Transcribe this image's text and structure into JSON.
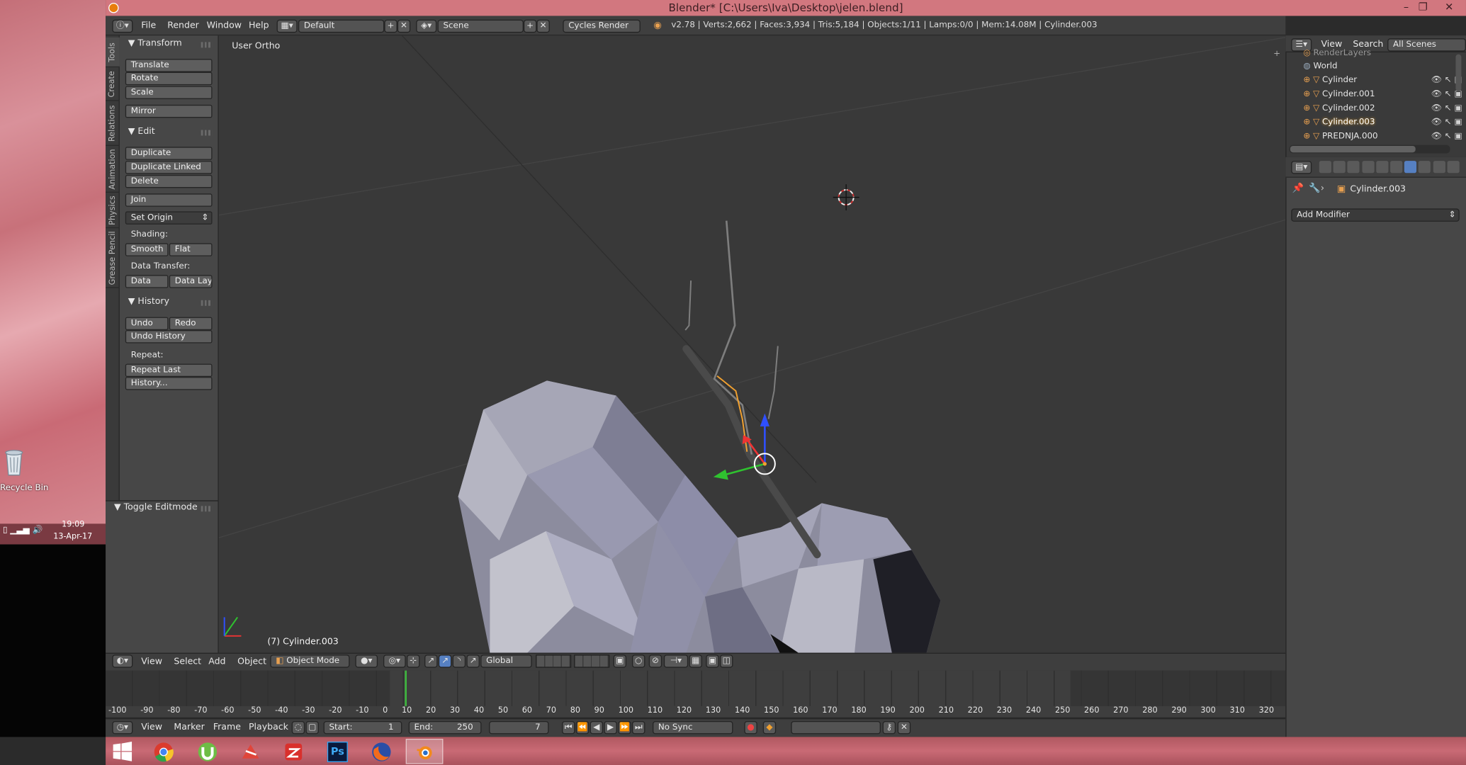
{
  "window": {
    "title": "Blender* [C:\\Users\\Iva\\Desktop\\jelen.blend]",
    "controls": [
      "–",
      "❐",
      "✕"
    ]
  },
  "menubar": {
    "menus": [
      "File",
      "Render",
      "Window",
      "Help"
    ],
    "screen_layout": "Default",
    "scene": "Scene",
    "render_engine": "Cycles Render",
    "stats": "v2.78 | Verts:2,662 | Faces:3,934 | Tris:5,184 | Objects:1/11 | Lamps:0/0 | Mem:14.08M | Cylinder.003"
  },
  "left_tabs": [
    "Tools",
    "Create",
    "Relations",
    "Animation",
    "Physics",
    "Grease Pencil"
  ],
  "toolshelf": {
    "transform": {
      "title": "Transform",
      "buttons": [
        "Translate",
        "Rotate",
        "Scale",
        "Mirror"
      ]
    },
    "edit": {
      "title": "Edit",
      "buttons": [
        "Duplicate",
        "Duplicate Linked",
        "Delete",
        "Join"
      ],
      "set_origin": "Set Origin",
      "shading_label": "Shading:",
      "shading_buttons": [
        "Smooth",
        "Flat"
      ],
      "data_transfer_label": "Data Transfer:",
      "data_transfer_buttons": [
        "Data",
        "Data Layo"
      ]
    },
    "history": {
      "title": "History",
      "undo": "Undo",
      "redo": "Redo",
      "undo_history": "Undo History",
      "repeat_label": "Repeat:",
      "repeat_last": "Repeat Last",
      "history": "History..."
    },
    "operator_panel": {
      "title": "Toggle Editmode"
    }
  },
  "viewport": {
    "view_label": "User Ortho",
    "object_label": "(7) Cylinder.003"
  },
  "viewport_header": {
    "menus": [
      "View",
      "Select",
      "Add",
      "Object"
    ],
    "mode": "Object Mode",
    "orientation": "Global"
  },
  "timeline": {
    "ticks": [
      "-100",
      "-90",
      "-80",
      "-70",
      "-60",
      "-50",
      "-40",
      "-30",
      "-20",
      "-10",
      "0",
      "10",
      "20",
      "30",
      "40",
      "50",
      "60",
      "70",
      "80",
      "90",
      "100",
      "110",
      "120",
      "130",
      "140",
      "150",
      "160",
      "170",
      "180",
      "190",
      "200",
      "210",
      "220",
      "230",
      "240",
      "250",
      "260",
      "270",
      "280",
      "290",
      "300",
      "310",
      "320"
    ],
    "current_frame_value": 7,
    "menus": [
      "View",
      "Marker",
      "Frame",
      "Playback"
    ],
    "start_label": "Start:",
    "start": "1",
    "end_label": "End:",
    "end": "250",
    "frame": "7",
    "sync": "No Sync"
  },
  "outliner": {
    "menus": [
      "View",
      "Search"
    ],
    "filter": "All Scenes",
    "items": [
      {
        "name": "RenderLayers"
      },
      {
        "name": "World"
      },
      {
        "name": "Cylinder"
      },
      {
        "name": "Cylinder.001"
      },
      {
        "name": "Cylinder.002"
      },
      {
        "name": "Cylinder.003",
        "selected": true
      },
      {
        "name": "PREDNJA.000"
      }
    ]
  },
  "properties": {
    "object_name": "Cylinder.003",
    "add_modifier": "Add Modifier"
  },
  "desktop": {
    "recycle_bin": "Recycle Bin",
    "time": "19:09",
    "date": "13-Apr-17"
  },
  "taskbar": {
    "apps": [
      "windows-start-icon",
      "chrome-icon",
      "utorrent-icon",
      "filezilla-icon",
      "wps-icon",
      "photoshop-icon",
      "firefox-icon",
      "blender-icon"
    ],
    "photoshop_label": "Ps"
  },
  "colors": {
    "title_bar": "#d2777f",
    "selection_orange": "#f0a030",
    "timeline_cursor": "#3fb83f",
    "outliner_highlight": "#f5a623"
  }
}
